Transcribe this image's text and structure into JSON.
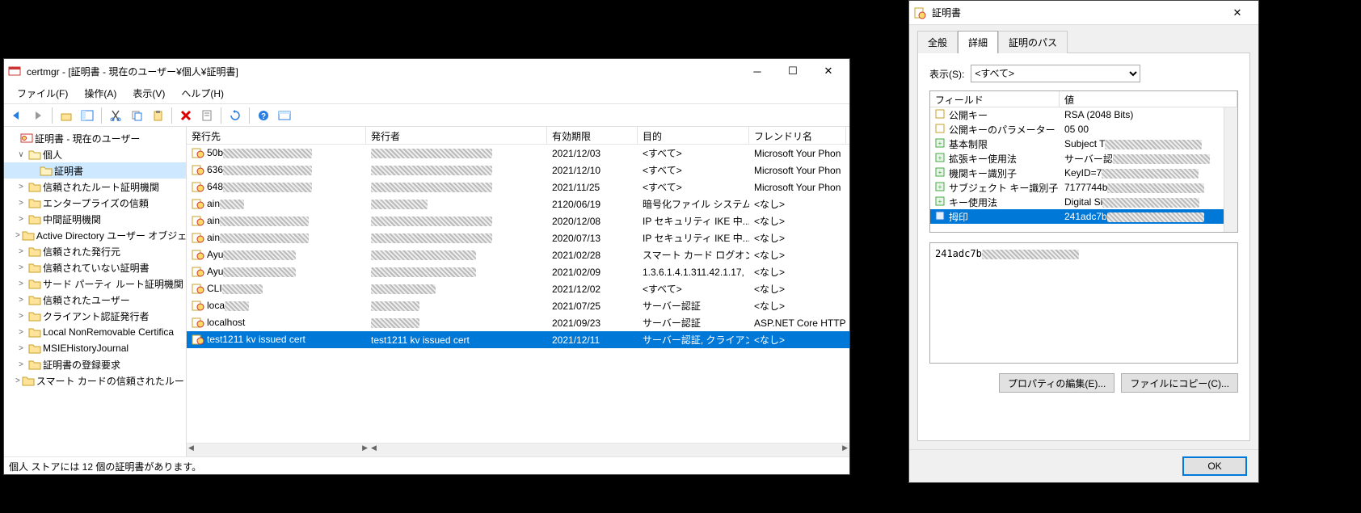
{
  "certmgr": {
    "title": "certmgr - [証明書 - 現在のユーザー¥個人¥証明書]",
    "menu": {
      "file": "ファイル(F)",
      "action": "操作(A)",
      "view": "表示(V)",
      "help": "ヘルプ(H)"
    },
    "tree": {
      "root": "証明書 - 現在のユーザー",
      "items": [
        {
          "label": "個人",
          "expanded": true,
          "children": [
            {
              "label": "証明書",
              "selected": true
            }
          ]
        },
        {
          "label": "信頼されたルート証明機関"
        },
        {
          "label": "エンタープライズの信頼"
        },
        {
          "label": "中間証明機関"
        },
        {
          "label": "Active Directory ユーザー オブジェ"
        },
        {
          "label": "信頼された発行元"
        },
        {
          "label": "信頼されていない証明書"
        },
        {
          "label": "サード パーティ ルート証明機関"
        },
        {
          "label": "信頼されたユーザー"
        },
        {
          "label": "クライアント認証発行者"
        },
        {
          "label": "Local NonRemovable Certifica"
        },
        {
          "label": "MSIEHistoryJournal"
        },
        {
          "label": "証明書の登録要求"
        },
        {
          "label": "スマート カードの信頼されたルート"
        }
      ]
    },
    "columns": {
      "a": "発行先",
      "b": "発行者",
      "c": "有効期限",
      "d": "目的",
      "e": "フレンドリ名"
    },
    "rows": [
      {
        "a": "50b",
        "ar": 110,
        "br": 150,
        "c": "2021/12/03",
        "d": "<すべて>",
        "e": "Microsoft Your Phon"
      },
      {
        "a": "636",
        "ar": 110,
        "br": 150,
        "c": "2021/12/10",
        "d": "<すべて>",
        "e": "Microsoft Your Phon"
      },
      {
        "a": "648",
        "ar": 110,
        "br": 150,
        "c": "2021/11/25",
        "d": "<すべて>",
        "e": "Microsoft Your Phon"
      },
      {
        "a": "ain",
        "ar": 30,
        "br": 70,
        "c": "2120/06/19",
        "d": "暗号化ファイル システム",
        "e": "<なし>"
      },
      {
        "a": "ain",
        "ar": 110,
        "br": 150,
        "c": "2020/12/08",
        "d": "IP セキュリティ IKE 中...",
        "e": "<なし>"
      },
      {
        "a": "ain",
        "ar": 110,
        "br": 150,
        "c": "2020/07/13",
        "d": "IP セキュリティ IKE 中...",
        "e": "<なし>"
      },
      {
        "a": "Ayu",
        "ar": 90,
        "br": 130,
        "c": "2021/02/28",
        "d": "スマート カード ログオン, ",
        "e": "<なし>"
      },
      {
        "a": "Ayu",
        "ar": 90,
        "br": 130,
        "c": "2021/02/09",
        "d": "1.3.6.1.4.1.311.42.1.17,",
        "e": "<なし>"
      },
      {
        "a": "CLI",
        "ar": 50,
        "br": 80,
        "c": "2021/12/02",
        "d": "<すべて>",
        "e": "<なし>"
      },
      {
        "a": "loca",
        "ar": 30,
        "br": 60,
        "c": "2021/07/25",
        "d": "サーバー認証",
        "e": "<なし>"
      },
      {
        "a": "localhost",
        "ar": 0,
        "br": 60,
        "c": "2021/09/23",
        "d": "サーバー認証",
        "e": "ASP.NET Core HTTPS"
      },
      {
        "a": "test1211 kv issued cert",
        "b": "test1211 kv issued cert",
        "c": "2021/12/11",
        "d": "サーバー認証, クライアン...",
        "e": "<なし>",
        "selected": true
      }
    ],
    "status": "個人 ストアには 12 個の証明書があります。"
  },
  "certdlg": {
    "title": "証明書",
    "tabs": {
      "general": "全般",
      "details": "詳細",
      "path": "証明のパス"
    },
    "show_label": "表示(S):",
    "show_value": "<すべて>",
    "pcol": {
      "a": "フィールド",
      "b": "値"
    },
    "props": [
      {
        "f": "公開キー",
        "v": "RSA (2048 Bits)",
        "icon": "doc"
      },
      {
        "f": "公開キーのパラメーター",
        "v": "05 00",
        "icon": "doc"
      },
      {
        "f": "基本制限",
        "v": "Subject T",
        "vr": 120,
        "icon": "ext"
      },
      {
        "f": "拡張キー使用法",
        "v": "サーバー認",
        "vr": 120,
        "icon": "ext"
      },
      {
        "f": "機関キー識別子",
        "v": "KeyID=7",
        "vr": 120,
        "icon": "ext"
      },
      {
        "f": "サブジェクト キー識別子",
        "v": "7177744b",
        "vr": 120,
        "icon": "ext"
      },
      {
        "f": "キー使用法",
        "v": "Digital Si",
        "vr": 120,
        "icon": "ext"
      },
      {
        "f": "拇印",
        "v": "241adc7b",
        "vr": 120,
        "icon": "prop",
        "selected": true
      }
    ],
    "valuebox": "241adc7b",
    "valuebox_r": 120,
    "btn_edit": "プロパティの編集(E)...",
    "btn_copy": "ファイルにコピー(C)...",
    "btn_ok": "OK"
  }
}
